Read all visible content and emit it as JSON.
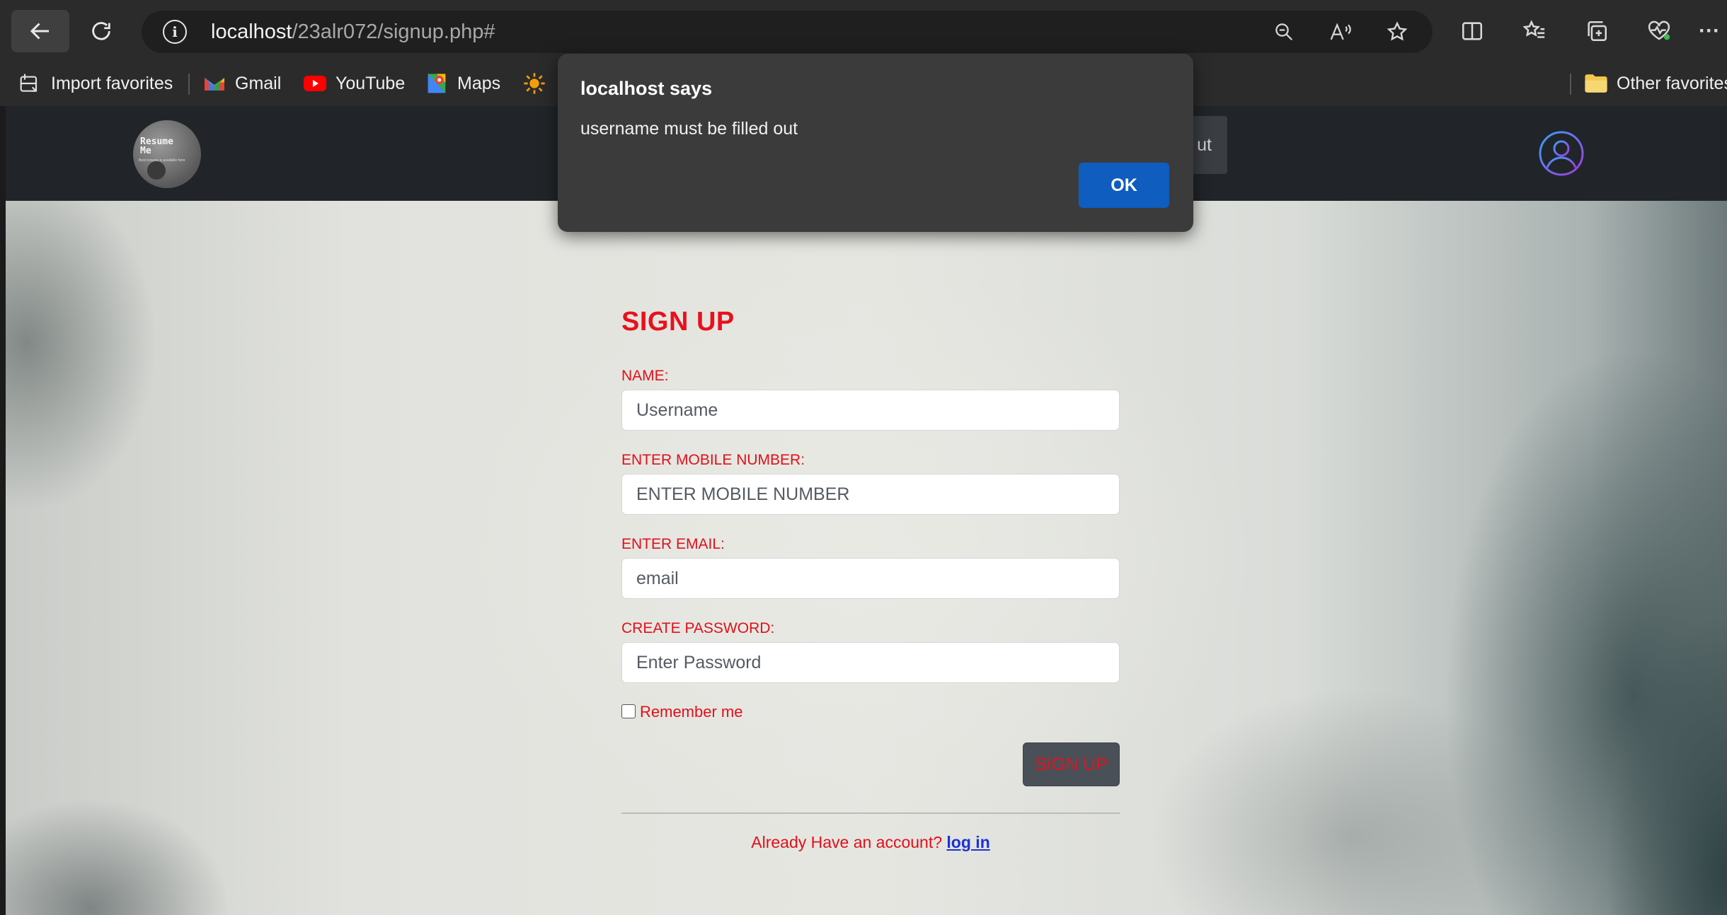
{
  "browser": {
    "url_host": "localhost",
    "url_path": "/23alr072/signup.php#",
    "bookmarks": [
      "Import favorites",
      "Gmail",
      "YouTube",
      "Maps"
    ],
    "other_favorites": "Other favorites"
  },
  "site_nav": {
    "logo_title": "Resume Me",
    "logo_tagline": "Best resume is available here",
    "hidden_button_tail": "ut"
  },
  "form": {
    "title": "SIGN UP",
    "name_label": "NAME:",
    "name_placeholder": "Username",
    "mobile_label": "ENTER MOBILE NUMBER:",
    "mobile_placeholder": "ENTER MOBILE NUMBER",
    "email_label": "ENTER EMAIL:",
    "email_placeholder": "email",
    "password_label": "CREATE PASSWORD:",
    "password_placeholder": "Enter Password",
    "remember_label": "Remember me",
    "remember_checked": false,
    "submit_label": "SIGN UP",
    "already_text": "Already Have an account?",
    "login_link": "log in"
  },
  "dialog": {
    "title": "localhost says",
    "message": "username must be filled out",
    "ok_label": "OK"
  },
  "colors": {
    "accent_red": "#e8111c",
    "link_blue": "#1a32d6",
    "ok_blue": "#0f5dbf",
    "nav_dark": "#212529"
  }
}
